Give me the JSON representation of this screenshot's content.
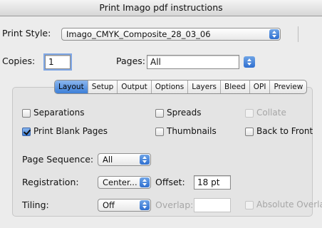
{
  "window": {
    "title": "Print Imago pdf instructions"
  },
  "print_style": {
    "label": "Print Style:",
    "value": "Imago_CMYK_Composite_28_03_06"
  },
  "copies": {
    "label": "Copies:",
    "value": "1"
  },
  "pages": {
    "label": "Pages:",
    "value": "All"
  },
  "tabs": [
    "Layout",
    "Setup",
    "Output",
    "Options",
    "Layers",
    "Bleed",
    "OPI",
    "Preview"
  ],
  "active_tab": "Layout",
  "checkboxes": {
    "separations": {
      "label": "Separations",
      "checked": false
    },
    "spreads": {
      "label": "Spreads",
      "checked": false
    },
    "collate": {
      "label": "Collate",
      "checked": false,
      "disabled": true
    },
    "print_blank_pages": {
      "label": "Print Blank Pages",
      "checked": true
    },
    "thumbnails": {
      "label": "Thumbnails",
      "checked": false
    },
    "back_to_front": {
      "label": "Back to Front",
      "checked": false
    }
  },
  "page_sequence": {
    "label": "Page Sequence:",
    "value": "All"
  },
  "registration": {
    "label": "Registration:",
    "value": "Center..."
  },
  "offset": {
    "label": "Offset:",
    "value": "18 pt"
  },
  "tiling": {
    "label": "Tiling:",
    "value": "Off"
  },
  "overlap": {
    "label": "Overlap:",
    "value": ""
  },
  "absolute_overlap": {
    "label": "Absolute Overlap",
    "checked": false,
    "disabled": true
  },
  "colors": {
    "accent": "#3d7fd8",
    "window_bg": "#ececec"
  }
}
